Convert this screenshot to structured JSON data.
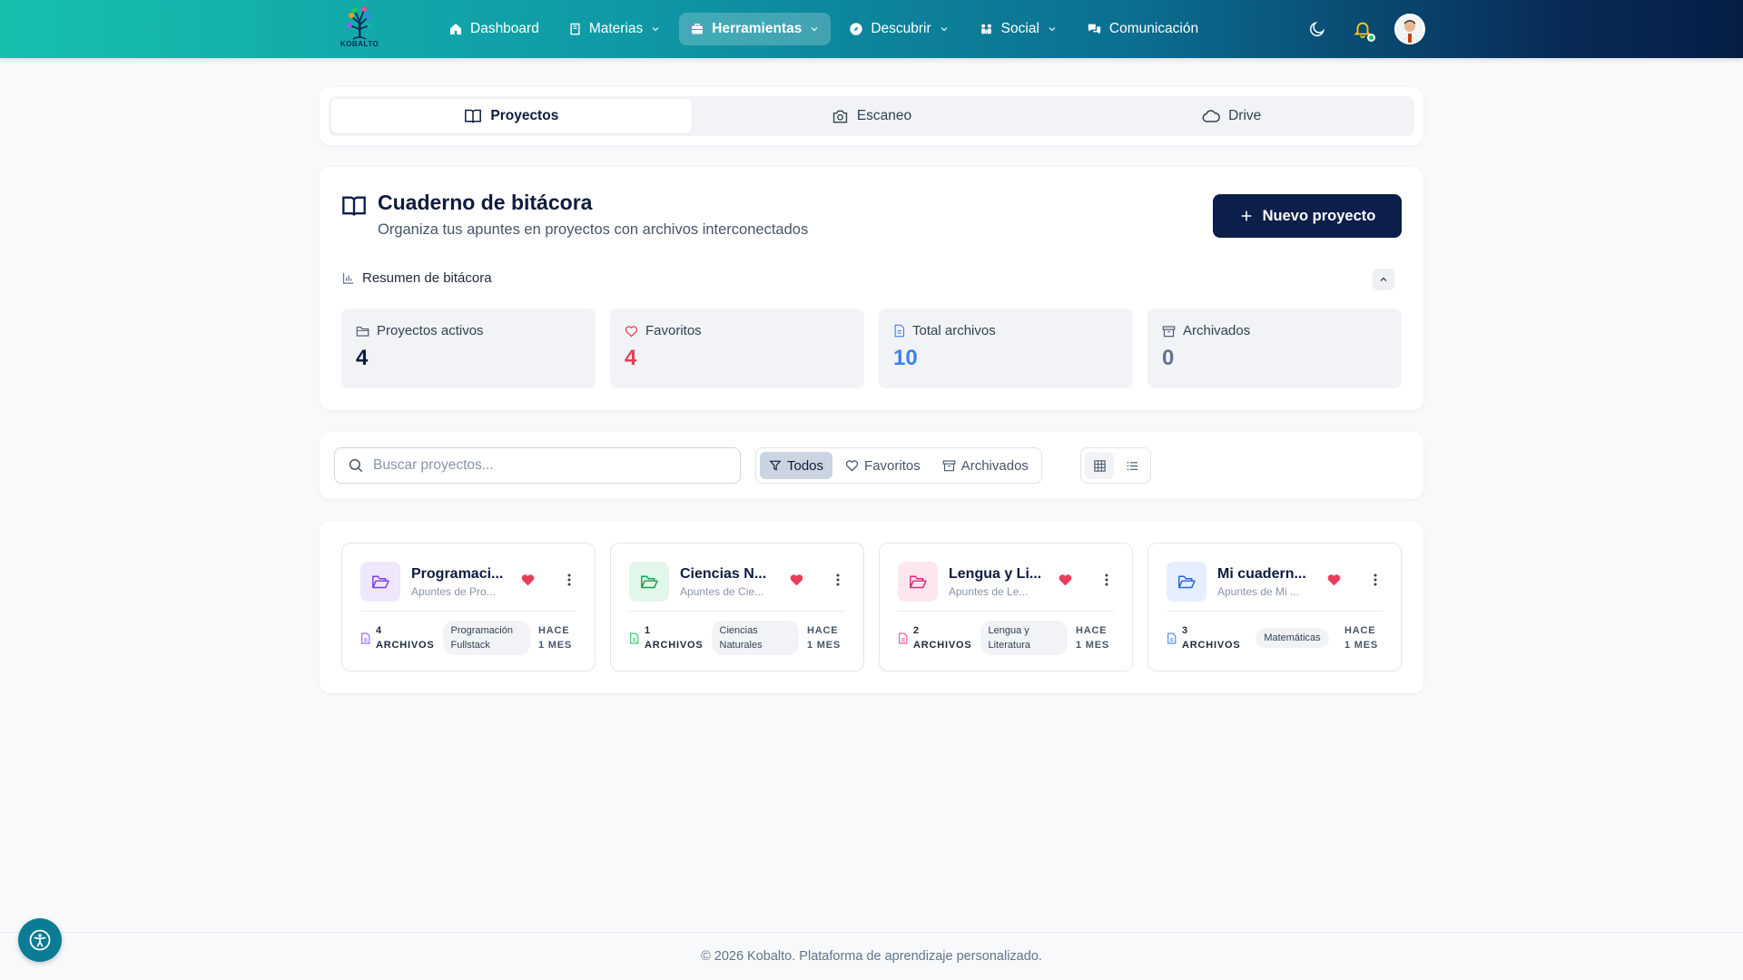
{
  "brand": {
    "logo_text": "KOBALTO"
  },
  "nav": {
    "items": [
      {
        "label": "Dashboard",
        "icon": "home-icon",
        "has_chevron": false,
        "active": false
      },
      {
        "label": "Materias",
        "icon": "book-icon",
        "has_chevron": true,
        "active": false
      },
      {
        "label": "Herramientas",
        "icon": "briefcase-icon",
        "has_chevron": true,
        "active": true
      },
      {
        "label": "Descubrir",
        "icon": "compass-icon",
        "has_chevron": true,
        "active": false
      },
      {
        "label": "Social",
        "icon": "users-icon",
        "has_chevron": true,
        "active": false
      },
      {
        "label": "Comunicación",
        "icon": "chat-icon",
        "has_chevron": false,
        "active": false
      }
    ],
    "right_icons": [
      "moon-icon",
      "bell-icon",
      "avatar"
    ]
  },
  "tabs": [
    {
      "label": "Proyectos",
      "icon": "book-open-icon",
      "active": true
    },
    {
      "label": "Escaneo",
      "icon": "camera-icon",
      "active": false
    },
    {
      "label": "Drive",
      "icon": "cloud-icon",
      "active": false
    }
  ],
  "header": {
    "title": "Cuaderno de bitácora",
    "subtitle": "Organiza tus apuntes en proyectos con archivos interconectados",
    "new_button": "Nuevo proyecto",
    "summary_label": "Resumen de bitácora"
  },
  "stats": [
    {
      "label": "Proyectos activos",
      "value": "4",
      "icon": "folder-icon",
      "color": "#0f1b3d"
    },
    {
      "label": "Favoritos",
      "value": "4",
      "icon": "heart-icon",
      "color": "#e83e5a"
    },
    {
      "label": "Total archivos",
      "value": "10",
      "icon": "file-icon",
      "color": "#3b82f6"
    },
    {
      "label": "Archivados",
      "value": "0",
      "icon": "archive-icon",
      "color": "#64748b"
    }
  ],
  "filters": {
    "search_placeholder": "Buscar proyectos...",
    "buttons": [
      {
        "label": "Todos",
        "icon": "filter-icon",
        "active": true
      },
      {
        "label": "Favoritos",
        "icon": "heart-icon",
        "active": false
      },
      {
        "label": "Archivados",
        "icon": "archive-icon",
        "active": false
      }
    ],
    "views": [
      {
        "name": "grid-view-icon",
        "active": true
      },
      {
        "name": "list-view-icon",
        "active": false
      }
    ]
  },
  "projects": [
    {
      "name": "Programaci...",
      "desc": "Apuntes de Pro...",
      "files": "4 ARCHIVOS",
      "tag": "Programación Fullstack",
      "time": "HACE 1 MES",
      "icon_bg": "#efe7fb",
      "icon_color": "#7c3aed"
    },
    {
      "name": "Ciencias N...",
      "desc": "Apuntes de Cie...",
      "files": "1 ARCHIVOS",
      "tag": "Ciencias Naturales",
      "time": "HACE 1 MES",
      "icon_bg": "#e3f6ec",
      "icon_color": "#16a34a"
    },
    {
      "name": "Lengua y Li...",
      "desc": "Apuntes de Le...",
      "files": "2 ARCHIVOS",
      "tag": "Lengua y Literatura",
      "time": "HACE 1 MES",
      "icon_bg": "#fce7ee",
      "icon_color": "#db2777"
    },
    {
      "name": "Mi cuadern...",
      "desc": "Apuntes de Mi ...",
      "files": "3 ARCHIVOS",
      "tag": "Matemáticas",
      "time": "HACE 1 MES",
      "icon_bg": "#e6efff",
      "icon_color": "#2563eb"
    }
  ],
  "colors": {
    "primary_dark": "#0c1f4a",
    "heart": "#e83e5a",
    "accent_teal": "#17bfae"
  },
  "footer": {
    "text": "© 2026 Kobalto. Plataforma de aprendizaje personalizado."
  }
}
